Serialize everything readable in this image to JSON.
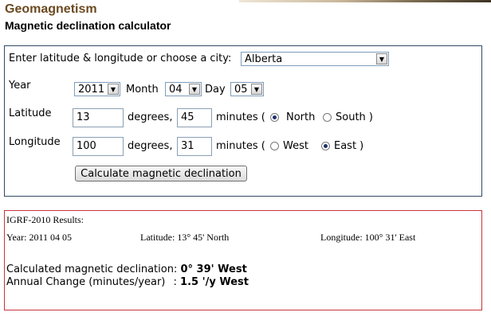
{
  "header": {
    "title": "Geomagnetism",
    "subtitle": "Magnetic declination calculator"
  },
  "form": {
    "city_prompt": "Enter latitude & longitude or choose a city:",
    "city_selected": "Alberta",
    "year_label": "Year",
    "year_value": "2011",
    "month_label": "Month",
    "month_value": "04",
    "day_label": "Day",
    "day_value": "05",
    "latitude_label": "Latitude",
    "latitude_degrees": "13",
    "latitude_minutes": "45",
    "degrees_label": "degrees,",
    "minutes_label": "minutes (",
    "north_label": "North",
    "south_label": "South )",
    "latitude_hemisphere": "North",
    "longitude_label": "Longitude",
    "longitude_degrees": "100",
    "longitude_minutes": "31",
    "west_label": "West",
    "east_label": "East )",
    "longitude_hemisphere": "East",
    "calculate_button": "Calculate magnetic declination"
  },
  "results": {
    "heading": "IGRF-2010 Results:",
    "date": "Year: 2011 04 05",
    "latitude": "Latitude: 13° 45' North",
    "longitude": "Longitude: 100° 31' East",
    "declination_label": "Calculated magnetic declination:",
    "declination_value": "0° 39' West",
    "annual_change_label": "Annual Change (minutes/year)",
    "annual_change_sep": ":",
    "annual_change_value": "1.5 '/y West"
  },
  "icons": {
    "dropdown": "chevron-down-icon",
    "radio_selected": "radio-checked-icon",
    "radio_unselected": "radio-unchecked-icon"
  },
  "colors": {
    "title": "#6b4a22",
    "form_border": "#2f4a63",
    "results_border": "#c8343c"
  }
}
